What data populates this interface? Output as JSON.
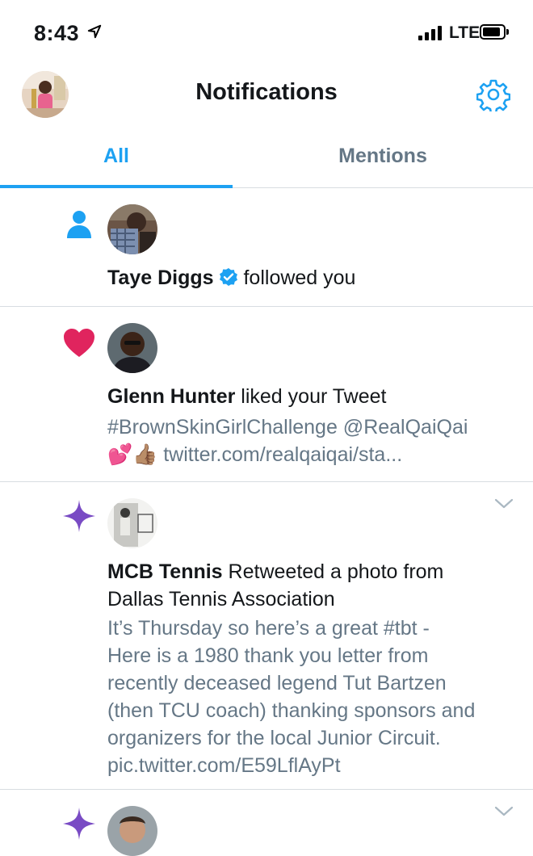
{
  "status_bar": {
    "time": "8:43",
    "network": "LTE"
  },
  "header": {
    "title": "Notifications"
  },
  "tabs": [
    {
      "label": "All",
      "active": true
    },
    {
      "label": "Mentions",
      "active": false
    }
  ],
  "notifications": [
    {
      "type_icon": "person-follow-icon",
      "user": "Taye Diggs",
      "verified": true,
      "action": "followed you"
    },
    {
      "type_icon": "heart-icon",
      "user": "Glenn Hunter",
      "action": "liked your Tweet",
      "preview_line1": "#BrownSkinGirlChallenge @RealQaiQai",
      "preview_emoji": "💕👍🏽",
      "preview_link": "twitter.com/realqaiqai/sta..."
    },
    {
      "type_icon": "sparkle-icon",
      "user": "MCB Tennis",
      "action_line1": "Retweeted a photo from",
      "action_line2": "Dallas Tennis Association",
      "preview_lines": [
        "It’s Thursday so here’s a great #tbt -",
        "Here is a 1980 thank you letter from",
        "recently deceased legend Tut Bartzen",
        "(then TCU coach) thanking sponsors and",
        "organizers for the local Junior Circuit.",
        "pic.twitter.com/E59LflAyPt"
      ]
    },
    {
      "type_icon": "sparkle-icon"
    }
  ],
  "colors": {
    "accent": "#1da1f2",
    "like": "#e0245e",
    "sparkle": "#794bc4",
    "secondary_text": "#657786"
  }
}
